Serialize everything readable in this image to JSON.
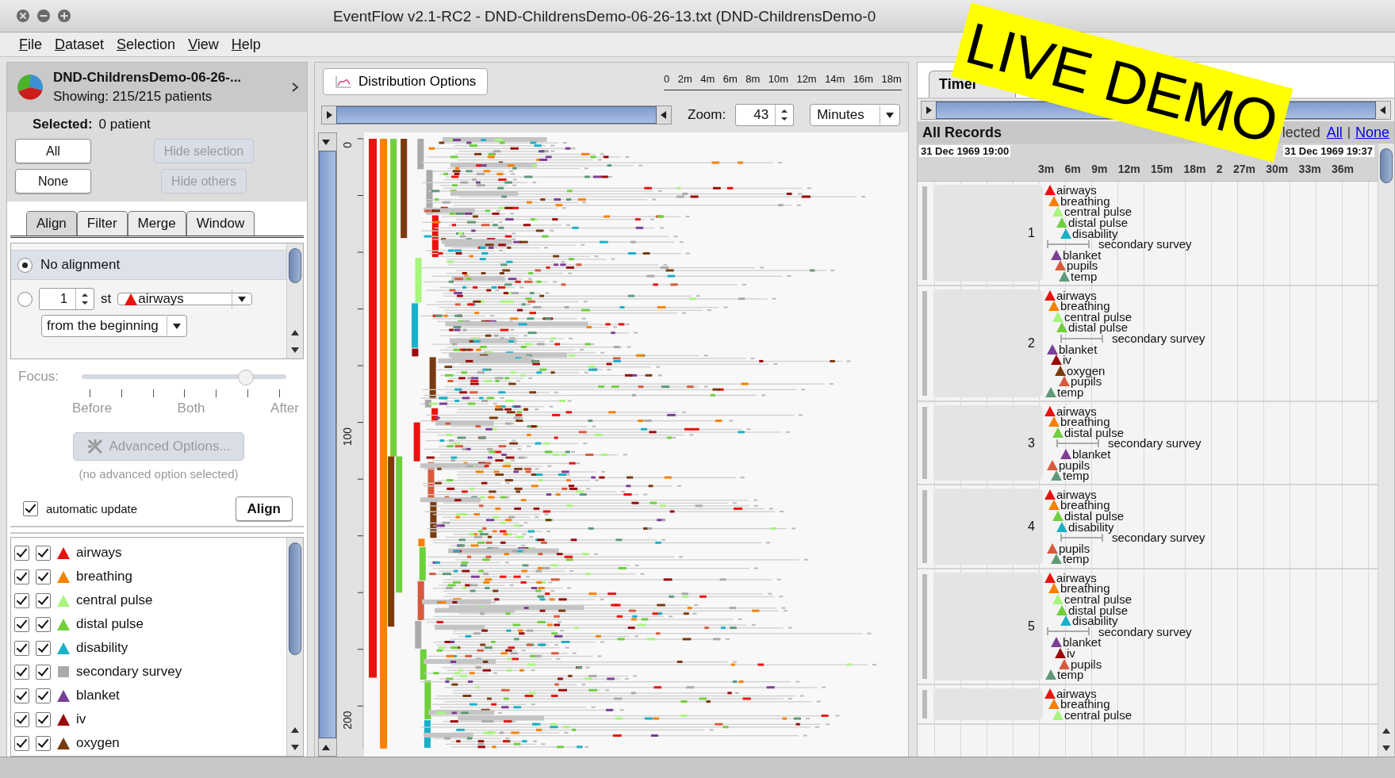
{
  "window": {
    "title": "EventFlow v2.1-RC2 - DND-ChildrensDemo-06-26-13.txt (DND-ChildrensDemo-0"
  },
  "menu": [
    "File",
    "Dataset",
    "Selection",
    "View",
    "Help"
  ],
  "dataset": {
    "name": "DND-ChildrensDemo-06-26-...",
    "showing": "Showing:  215/215 patients"
  },
  "selection": {
    "label": "Selected:",
    "value": "0 patient"
  },
  "selection_buttons": [
    {
      "label": "All",
      "disabled": false
    },
    {
      "label": "Hide selection",
      "disabled": true
    },
    {
      "label": "None",
      "disabled": false
    },
    {
      "label": "Hide others",
      "disabled": true
    }
  ],
  "tabs": [
    {
      "label": "Align",
      "selected": true
    },
    {
      "label": "Filter",
      "selected": false
    },
    {
      "label": "Merge",
      "selected": false
    },
    {
      "label": "Window",
      "selected": false
    }
  ],
  "alignment": {
    "none_option": {
      "label": "No alignment",
      "selected": true
    },
    "event_option": {
      "selected": false,
      "count": "1",
      "ordinal": "st",
      "event": "airways",
      "anchor": "from the beginning"
    }
  },
  "focus": {
    "label": "Focus:",
    "level": 0.8,
    "ticks": [
      "Before",
      "Both",
      "After"
    ]
  },
  "advanced": {
    "label": "Advanced Options...",
    "disabled": true,
    "note": "(no advanced option selected)"
  },
  "auto_update": {
    "label": "automatic update",
    "checked": true
  },
  "align_button": "Align",
  "categories": [
    {
      "name": "airways",
      "kind": "triangle",
      "color": "#e8130f",
      "checked_1": true,
      "checked_2": true
    },
    {
      "name": "breathing",
      "kind": "triangle",
      "color": "#f98000",
      "checked_1": true,
      "checked_2": true
    },
    {
      "name": "central pulse",
      "kind": "triangle",
      "color": "#a8f57d",
      "checked_1": true,
      "checked_2": true
    },
    {
      "name": "distal pulse",
      "kind": "triangle",
      "color": "#6fcf3c",
      "checked_1": true,
      "checked_2": true
    },
    {
      "name": "disability",
      "kind": "triangle",
      "color": "#1ab0c8",
      "checked_1": true,
      "checked_2": true
    },
    {
      "name": "secondary survey",
      "kind": "square",
      "color": "#aaaaaa",
      "checked_1": true,
      "checked_2": true
    },
    {
      "name": "blanket",
      "kind": "triangle",
      "color": "#7b3f96",
      "checked_1": true,
      "checked_2": true
    },
    {
      "name": "iv",
      "kind": "triangle",
      "color": "#9a0a0a",
      "checked_1": true,
      "checked_2": true
    },
    {
      "name": "oxygen",
      "kind": "triangle",
      "color": "#7a3a10",
      "checked_1": true,
      "checked_2": true
    }
  ],
  "distribution": {
    "options_button": "Distribution Options",
    "x_ticks": [
      "0",
      "2m",
      "4m",
      "6m",
      "8m",
      "10m",
      "12m",
      "14m",
      "16m",
      "18m"
    ],
    "zoom_label": "Zoom:",
    "zoom_value": "43",
    "unit": "Minutes",
    "y_ticks": [
      "0",
      "100",
      "200"
    ]
  },
  "timeline": {
    "tab": "Timel",
    "header": "All Records",
    "selected_text": "lected",
    "links": [
      "All",
      "None"
    ],
    "separator": "|",
    "start_date": "31 Dec 1969 19:00",
    "end_date": "31 Dec 1969 19:37",
    "ticks": [
      "3m",
      "6m",
      "9m",
      "12m",
      "15m",
      "18m",
      "2",
      "27m",
      "30m",
      "33m",
      "36m"
    ],
    "records": [
      {
        "number": "1",
        "events": [
          {
            "name": "airways",
            "kind": "point",
            "color": "#e8130f"
          },
          {
            "name": "breathing",
            "kind": "point",
            "color": "#f98000"
          },
          {
            "name": "central pulse",
            "kind": "point",
            "color": "#a8f57d"
          },
          {
            "name": "distal pulse",
            "kind": "point",
            "color": "#6fcf3c"
          },
          {
            "name": "disability",
            "kind": "point",
            "color": "#1ab0c8"
          },
          {
            "name": "secondary survey",
            "kind": "interval",
            "color": "#aaaaaa"
          },
          {
            "name": "blanket",
            "kind": "point",
            "color": "#7b3f96"
          },
          {
            "name": "pupils",
            "kind": "point",
            "color": "#d85a3c"
          },
          {
            "name": "temp",
            "kind": "point",
            "color": "#5f9a78"
          }
        ]
      },
      {
        "number": "2",
        "events": [
          {
            "name": "airways",
            "kind": "point",
            "color": "#e8130f"
          },
          {
            "name": "breathing",
            "kind": "point",
            "color": "#f98000"
          },
          {
            "name": "central pulse",
            "kind": "point",
            "color": "#a8f57d"
          },
          {
            "name": "distal pulse",
            "kind": "point",
            "color": "#6fcf3c"
          },
          {
            "name": "secondary survey",
            "kind": "interval",
            "color": "#aaaaaa"
          },
          {
            "name": "blanket",
            "kind": "point",
            "color": "#7b3f96"
          },
          {
            "name": "iv",
            "kind": "point",
            "color": "#9a0a0a"
          },
          {
            "name": "oxygen",
            "kind": "point",
            "color": "#7a3a10"
          },
          {
            "name": "pupils",
            "kind": "point",
            "color": "#d85a3c"
          },
          {
            "name": "temp",
            "kind": "point",
            "color": "#5f9a78"
          }
        ]
      },
      {
        "number": "3",
        "events": [
          {
            "name": "airways",
            "kind": "point",
            "color": "#e8130f"
          },
          {
            "name": "breathing",
            "kind": "point",
            "color": "#f98000"
          },
          {
            "name": "distal pulse",
            "kind": "point",
            "color": "#6fcf3c"
          },
          {
            "name": "secondary survey",
            "kind": "interval",
            "color": "#aaaaaa"
          },
          {
            "name": "blanket",
            "kind": "point",
            "color": "#7b3f96"
          },
          {
            "name": "pupils",
            "kind": "point",
            "color": "#d85a3c"
          },
          {
            "name": "temp",
            "kind": "point",
            "color": "#5f9a78"
          }
        ]
      },
      {
        "number": "4",
        "events": [
          {
            "name": "airways",
            "kind": "point",
            "color": "#e8130f"
          },
          {
            "name": "breathing",
            "kind": "point",
            "color": "#f98000"
          },
          {
            "name": "distal pulse",
            "kind": "point",
            "color": "#6fcf3c"
          },
          {
            "name": "disability",
            "kind": "point",
            "color": "#1ab0c8"
          },
          {
            "name": "secondary survey",
            "kind": "interval",
            "color": "#aaaaaa"
          },
          {
            "name": "pupils",
            "kind": "point",
            "color": "#d85a3c"
          },
          {
            "name": "temp",
            "kind": "point",
            "color": "#5f9a78"
          }
        ]
      },
      {
        "number": "5",
        "events": [
          {
            "name": "airways",
            "kind": "point",
            "color": "#e8130f"
          },
          {
            "name": "breathing",
            "kind": "point",
            "color": "#f98000"
          },
          {
            "name": "central pulse",
            "kind": "point",
            "color": "#a8f57d"
          },
          {
            "name": "distal pulse",
            "kind": "point",
            "color": "#6fcf3c"
          },
          {
            "name": "disability",
            "kind": "point",
            "color": "#1ab0c8"
          },
          {
            "name": "secondary survey",
            "kind": "interval",
            "color": "#aaaaaa"
          },
          {
            "name": "blanket",
            "kind": "point",
            "color": "#7b3f96"
          },
          {
            "name": "iv",
            "kind": "point",
            "color": "#9a0a0a"
          },
          {
            "name": "pupils",
            "kind": "point",
            "color": "#d85a3c"
          },
          {
            "name": "temp",
            "kind": "point",
            "color": "#5f9a78"
          }
        ]
      },
      {
        "events": [
          {
            "name": "airways",
            "kind": "point",
            "color": "#e8130f"
          },
          {
            "name": "breathing",
            "kind": "point",
            "color": "#f98000"
          },
          {
            "name": "central pulse",
            "kind": "point",
            "color": "#a8f57d"
          }
        ]
      }
    ]
  },
  "banner": {
    "text": "LIVE DEMO"
  }
}
